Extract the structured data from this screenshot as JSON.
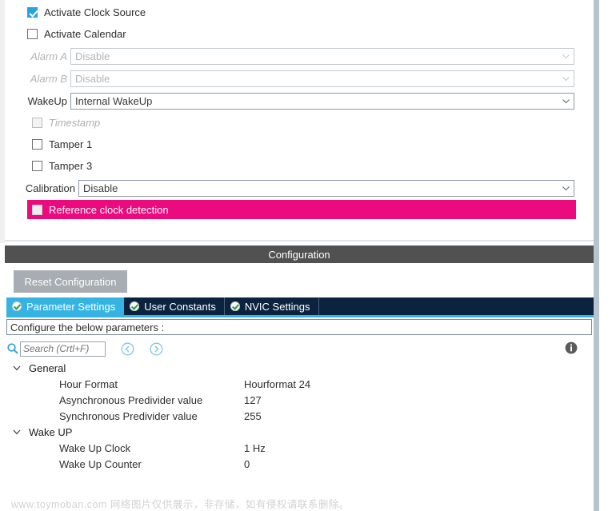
{
  "rtc_panel": {
    "checkboxes_top": [
      {
        "label": "Activate Clock Source",
        "checked": true,
        "disabled": false
      },
      {
        "label": "Activate Calendar",
        "checked": false,
        "disabled": false
      }
    ],
    "dropdowns": [
      {
        "label": "Alarm A",
        "value": "Disable",
        "disabled": true
      },
      {
        "label": "Alarm B",
        "value": "Disable",
        "disabled": true
      },
      {
        "label": "WakeUp",
        "value": "Internal WakeUp",
        "disabled": false
      }
    ],
    "checkboxes_mid": [
      {
        "label": "Timestamp",
        "checked": false,
        "disabled": true
      },
      {
        "label": "Tamper 1",
        "checked": false,
        "disabled": false
      },
      {
        "label": "Tamper 3",
        "checked": false,
        "disabled": false
      }
    ],
    "calibration": {
      "label": "Calibration",
      "value": "Disable",
      "disabled": false
    },
    "highlight_row": {
      "label": "Reference clock detection",
      "checked": false,
      "color": "#ec0a7f"
    }
  },
  "config": {
    "header_title": "Configuration",
    "reset_button": "Reset Configuration",
    "tabs": [
      {
        "label": "Parameter Settings",
        "active": true
      },
      {
        "label": "User Constants",
        "active": false
      },
      {
        "label": "NVIC Settings",
        "active": false
      }
    ],
    "banner": "Configure the below parameters :",
    "search": {
      "placeholder": "Search (Crtl+F)",
      "value": ""
    },
    "groups": [
      {
        "name": "General",
        "expanded": true,
        "rows": [
          {
            "name": "Hour Format",
            "value": "Hourformat 24"
          },
          {
            "name": "Asynchronous Predivider value",
            "value": "127"
          },
          {
            "name": "Synchronous Predivider value",
            "value": "255"
          }
        ]
      },
      {
        "name": "Wake UP",
        "expanded": true,
        "rows": [
          {
            "name": "Wake Up Clock",
            "value": "1 Hz"
          },
          {
            "name": "Wake Up Counter",
            "value": "0"
          }
        ]
      }
    ]
  },
  "footer": {
    "watermark": "www.toymoban.com 网络图片仅供展示，非存储，如有侵权请联系删除。"
  },
  "colors": {
    "accent_blue": "#35b4e3",
    "tab_navy": "#0c2340",
    "header_gray": "#515151",
    "highlight_magenta": "#ec0a7f",
    "button_gray": "#a7adb2"
  }
}
